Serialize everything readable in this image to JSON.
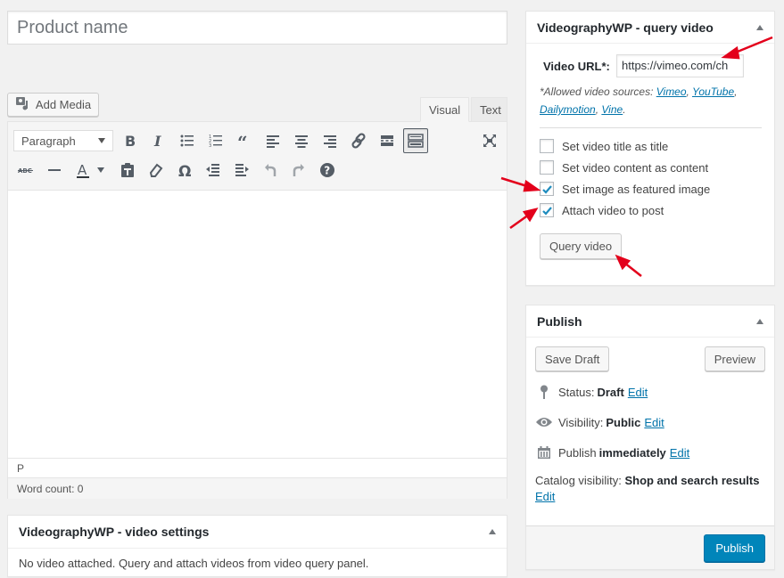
{
  "title_field": {
    "placeholder": "Product name"
  },
  "media": {
    "add_media_label": "Add Media"
  },
  "editor": {
    "tabs": [
      {
        "label": "Visual",
        "active": true
      },
      {
        "label": "Text",
        "active": false
      }
    ],
    "format_select": "Paragraph",
    "toolbar_row1": [
      "bold-icon",
      "italic-icon",
      "bullet-list-icon",
      "numbered-list-icon",
      "blockquote-icon",
      "align-left-icon",
      "align-center-icon",
      "align-right-icon",
      "link-icon",
      "read-more-icon",
      "toolbar-toggle-icon",
      "fullscreen-icon"
    ],
    "toolbar_row2": [
      "strikethrough-icon",
      "horizontal-line-icon",
      "text-color-icon",
      "paste-text-icon",
      "clear-formatting-icon",
      "special-character-icon",
      "outdent-icon",
      "indent-icon",
      "undo-icon",
      "redo-icon",
      "help-icon"
    ],
    "path": "P",
    "word_count": "Word count: 0"
  },
  "video_settings": {
    "title": "VideographyWP - video settings",
    "message": "No video attached. Query and attach videos from video query panel."
  },
  "query_video": {
    "title": "VideographyWP - query video",
    "url_label": "Video URL*:",
    "url_value": "https://vimeo.com/ch",
    "allowed_prefix": "*Allowed video sources: ",
    "sources": [
      "Vimeo",
      "YouTube",
      "Dailymotion",
      "Vine"
    ],
    "options": [
      {
        "label": "Set video title as title",
        "checked": false
      },
      {
        "label": "Set video content as content",
        "checked": false
      },
      {
        "label": "Set image as featured image",
        "checked": true
      },
      {
        "label": "Attach video to post",
        "checked": true
      }
    ],
    "query_button": "Query video"
  },
  "publish": {
    "title": "Publish",
    "save_draft": "Save Draft",
    "preview": "Preview",
    "status_label": "Status:",
    "status_value": "Draft",
    "visibility_label": "Visibility:",
    "visibility_value": "Public",
    "schedule_label": "Publish",
    "schedule_value": "immediately",
    "edit_label": "Edit",
    "catalog_label": "Catalog visibility:",
    "catalog_value": "Shop and search results",
    "publish_button": "Publish"
  },
  "colors": {
    "accent": "#0085ba",
    "link": "#0073aa",
    "annotation": "#e3001b",
    "background": "#f1f1f1"
  }
}
